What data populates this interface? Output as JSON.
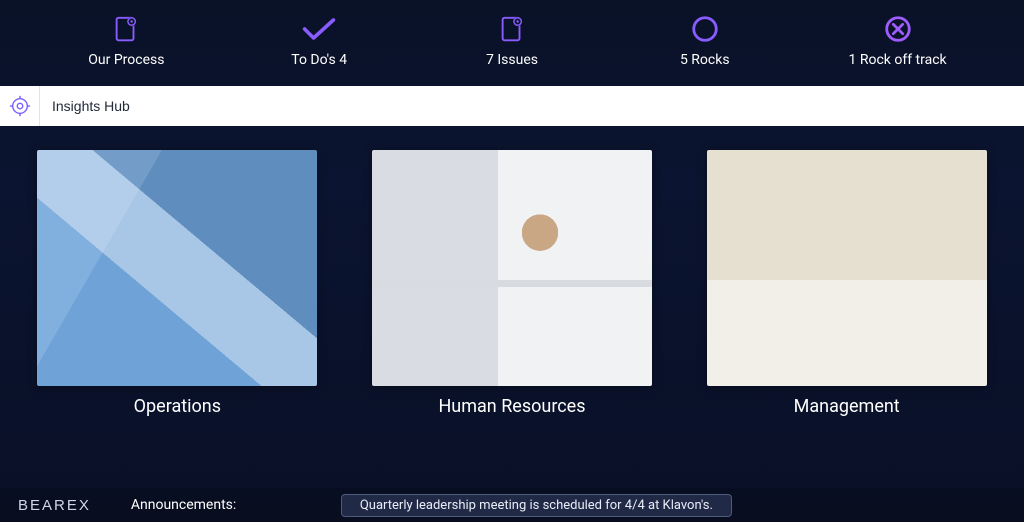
{
  "nav": {
    "items": [
      {
        "label": "Our Process",
        "icon": "clipboard-gear-icon"
      },
      {
        "label": "To Do's 4",
        "icon": "checkmark-icon"
      },
      {
        "label": "7 Issues",
        "icon": "clipboard-gear-icon"
      },
      {
        "label": "5 Rocks",
        "icon": "ring-icon"
      },
      {
        "label": "1 Rock off track",
        "icon": "x-ring-icon"
      }
    ]
  },
  "insights": {
    "value": "Insights Hub",
    "icon": "gear-target-icon"
  },
  "cards": [
    {
      "title": "Operations",
      "thumb": "ops"
    },
    {
      "title": "Human Resources",
      "thumb": "hr"
    },
    {
      "title": "Management",
      "thumb": "mgmt"
    }
  ],
  "footer": {
    "brand": "BEAREX",
    "ann_label": "Announcements:",
    "ann_text": "Quarterly leadership meeting is scheduled for 4/4 at Klavon's."
  },
  "colors": {
    "accent": "#7a5cff",
    "accent2": "#4e6bff",
    "bg": "#0b1430"
  }
}
